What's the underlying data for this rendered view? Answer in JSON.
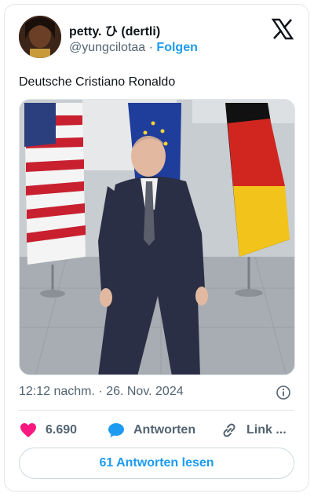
{
  "user": {
    "display_name": "petty. ひ (dertli)",
    "handle": "@yungcilotaa",
    "separator": "·",
    "follow_label": "Folgen"
  },
  "tweet": {
    "text": "Deutsche Cristiano Ronaldo",
    "time": "12:12 nachm.",
    "dot": "·",
    "date": "26. Nov. 2024"
  },
  "actions": {
    "likes": "6.690",
    "reply_label": "Antworten",
    "link_label": "Link ..."
  },
  "read_replies_label": "61 Antworten lesen",
  "colors": {
    "accent": "#1d9bf0",
    "like": "#f91880",
    "muted": "#536471"
  },
  "icons": [
    "x-logo-icon",
    "info-icon",
    "heart-icon",
    "reply-bubble-icon",
    "link-icon"
  ]
}
